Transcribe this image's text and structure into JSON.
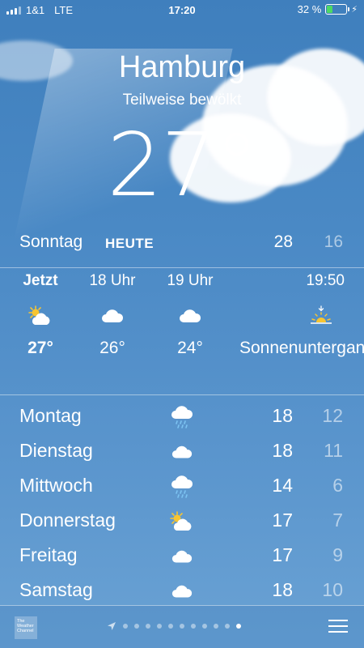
{
  "status_bar": {
    "carrier": "1&1",
    "network": "LTE",
    "time": "17:20",
    "battery_text": "32 %",
    "battery_level": 0.32
  },
  "location": {
    "city": "Hamburg",
    "condition": "Teilweise bewölkt",
    "current_temp": "27°"
  },
  "today": {
    "day": "Sonntag",
    "label": "HEUTE",
    "high": "28",
    "low": "16"
  },
  "hourly": [
    {
      "time": "Jetzt",
      "icon": "partly-sunny-icon",
      "temp": "27°"
    },
    {
      "time": "18 Uhr",
      "icon": "cloud-icon",
      "temp": "26°"
    },
    {
      "time": "19 Uhr",
      "icon": "cloud-icon",
      "temp": "24°"
    },
    {
      "time": "19:50",
      "icon": "sunset-icon",
      "temp": "Sonnenuntergang"
    }
  ],
  "daily": [
    {
      "day": "Montag",
      "icon": "rain-cloud-icon",
      "high": "18",
      "low": "12"
    },
    {
      "day": "Dienstag",
      "icon": "cloud-icon",
      "high": "18",
      "low": "11"
    },
    {
      "day": "Mittwoch",
      "icon": "rain-cloud-icon",
      "high": "14",
      "low": "6"
    },
    {
      "day": "Donnerstag",
      "icon": "partly-sunny-icon",
      "high": "17",
      "low": "7"
    },
    {
      "day": "Freitag",
      "icon": "cloud-icon",
      "high": "17",
      "low": "9"
    },
    {
      "day": "Samstag",
      "icon": "cloud-icon",
      "high": "18",
      "low": "10"
    }
  ],
  "bottom_bar": {
    "logo_text": "The Weather Channel",
    "page_count": 11,
    "active_page": 11
  },
  "colors": {
    "battery_fill": "#4cd964",
    "sun": "#f7c531"
  }
}
